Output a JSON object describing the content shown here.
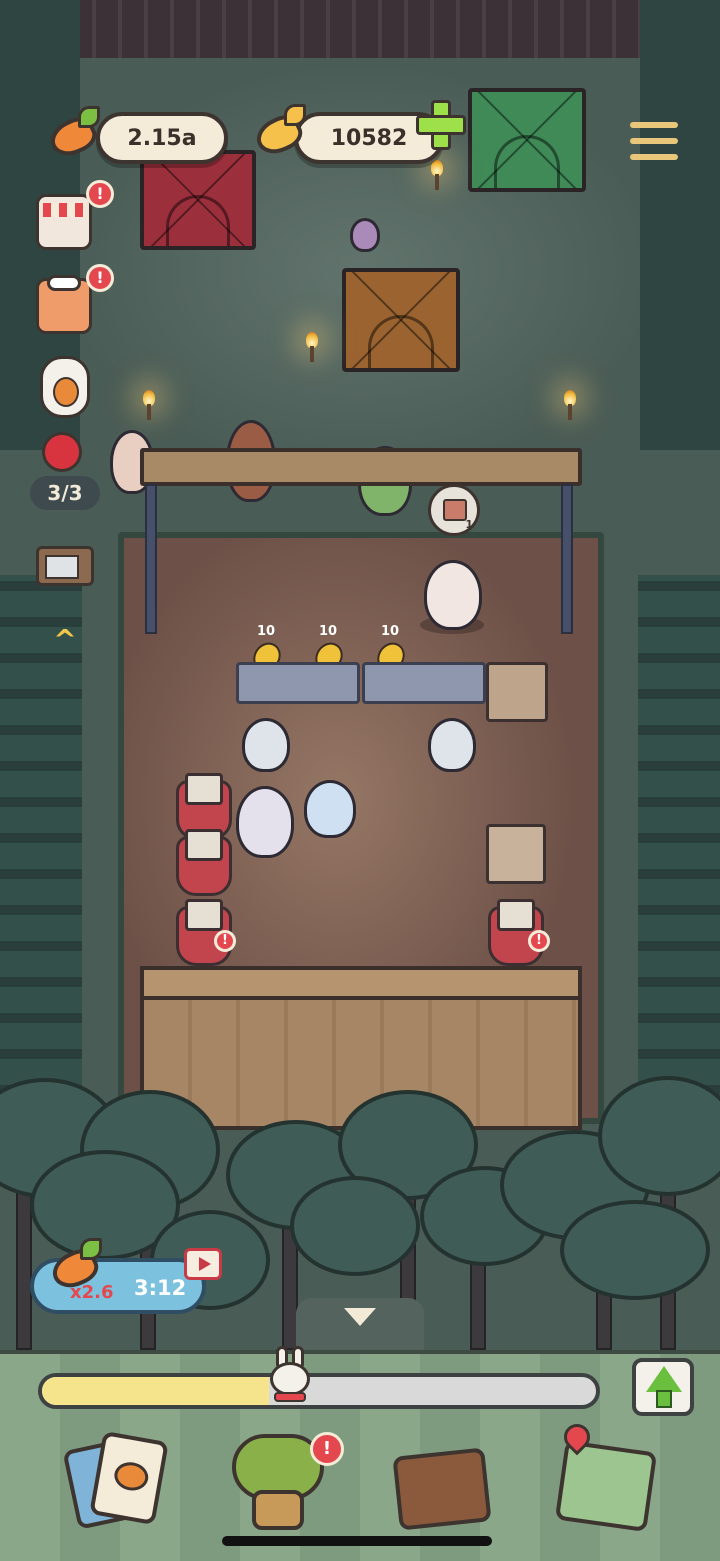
{
  "hud": {
    "carrot_rate": "2.15a",
    "gold_carrots": "10582"
  },
  "sidebar": {
    "shop_alert": "!",
    "chef_alert": "!",
    "customers_count": "3/3"
  },
  "stage": {
    "order_bubble_count": "1",
    "carrot_drops": [
      "10",
      "10",
      "10"
    ],
    "stool_alerts": [
      "!",
      "!"
    ]
  },
  "boost": {
    "multiplier": "x2.6",
    "timer": "3:12"
  },
  "progress": {
    "fraction": 0.41
  },
  "nav": {
    "upgrade_alert": "!",
    "items": [
      "recipes-cards-icon",
      "tree-house-icon",
      "toolbox-icon",
      "map-icon"
    ]
  },
  "colors": {
    "alert": "#e5474f",
    "plus": "#9ee04a",
    "progress_fill": "#f5e48c",
    "boost_bg": "#7cc2df"
  }
}
